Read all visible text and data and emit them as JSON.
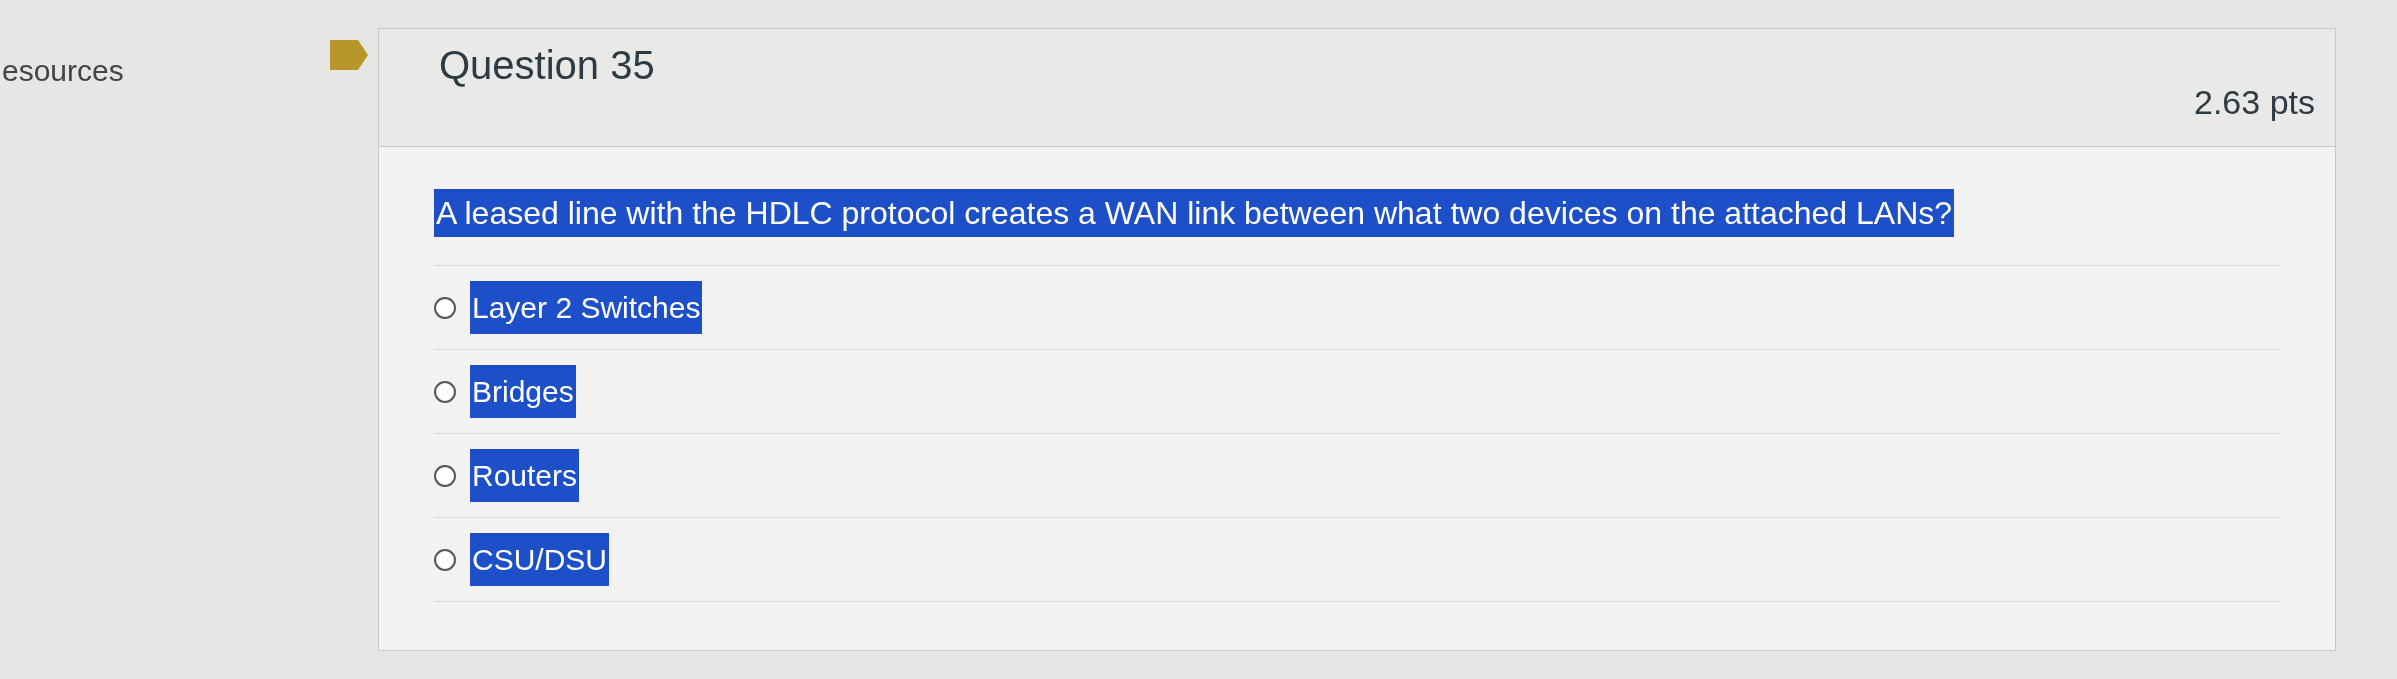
{
  "sidebar": {
    "label": "esources"
  },
  "question": {
    "title": "Question 35",
    "points": "2.63 pts",
    "text": "A leased line with the HDLC protocol creates a WAN link between what two devices on the attached LANs?",
    "highlighted": true,
    "answers": [
      {
        "label": "Layer 2 Switches",
        "selected": false,
        "highlighted": true
      },
      {
        "label": "Bridges",
        "selected": false,
        "highlighted": true
      },
      {
        "label": "Routers",
        "selected": false,
        "highlighted": true
      },
      {
        "label": "CSU/DSU",
        "selected": false,
        "highlighted": true
      }
    ]
  }
}
